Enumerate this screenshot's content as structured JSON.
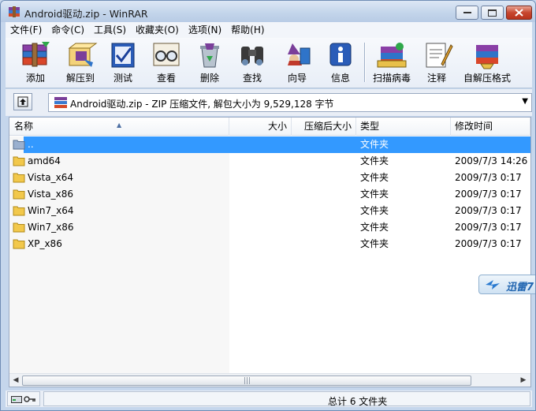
{
  "window": {
    "title": "Android驱动.zip - WinRAR"
  },
  "menu": [
    {
      "label": "文件(F)"
    },
    {
      "label": "命令(C)"
    },
    {
      "label": "工具(S)"
    },
    {
      "label": "收藏夹(O)"
    },
    {
      "label": "选项(N)"
    },
    {
      "label": "帮助(H)"
    }
  ],
  "toolbar": [
    {
      "label": "添加",
      "icon": "books-add-icon"
    },
    {
      "label": "解压到",
      "icon": "extract-to-icon"
    },
    {
      "label": "测试",
      "icon": "test-check-icon"
    },
    {
      "label": "查看",
      "icon": "view-glasses-icon"
    },
    {
      "label": "删除",
      "icon": "delete-recycle-icon"
    },
    {
      "label": "查找",
      "icon": "find-binoculars-icon"
    },
    {
      "label": "向导",
      "icon": "wizard-icon"
    },
    {
      "label": "信息",
      "icon": "info-icon"
    },
    {
      "label": "扫描病毒",
      "icon": "scan-virus-icon"
    },
    {
      "label": "注释",
      "icon": "comment-icon"
    },
    {
      "label": "自解压格式",
      "icon": "sfx-icon"
    }
  ],
  "address": {
    "path": "Android驱动.zip - ZIP 压缩文件, 解包大小为 9,529,128 字节"
  },
  "columns": {
    "name": "名称",
    "size": "大小",
    "packed": "压缩后大小",
    "type": "类型",
    "modified": "修改时间"
  },
  "files": [
    {
      "name": "..",
      "size": "",
      "packed": "",
      "type": "文件夹",
      "modified": "",
      "selected": true
    },
    {
      "name": "amd64",
      "size": "",
      "packed": "",
      "type": "文件夹",
      "modified": "2009/7/3 14:26"
    },
    {
      "name": "Vista_x64",
      "size": "",
      "packed": "",
      "type": "文件夹",
      "modified": "2009/7/3 0:17"
    },
    {
      "name": "Vista_x86",
      "size": "",
      "packed": "",
      "type": "文件夹",
      "modified": "2009/7/3 0:17"
    },
    {
      "name": "Win7_x64",
      "size": "",
      "packed": "",
      "type": "文件夹",
      "modified": "2009/7/3 0:17"
    },
    {
      "name": "Win7_x86",
      "size": "",
      "packed": "",
      "type": "文件夹",
      "modified": "2009/7/3 0:17"
    },
    {
      "name": "XP_x86",
      "size": "",
      "packed": "",
      "type": "文件夹",
      "modified": "2009/7/3 0:17"
    }
  ],
  "status": {
    "summary": "总计 6 文件夹"
  },
  "xunlei": {
    "label": "迅雷7"
  },
  "colors": {
    "selection": "#3399ff",
    "title_bg": "#c5d6ec"
  }
}
